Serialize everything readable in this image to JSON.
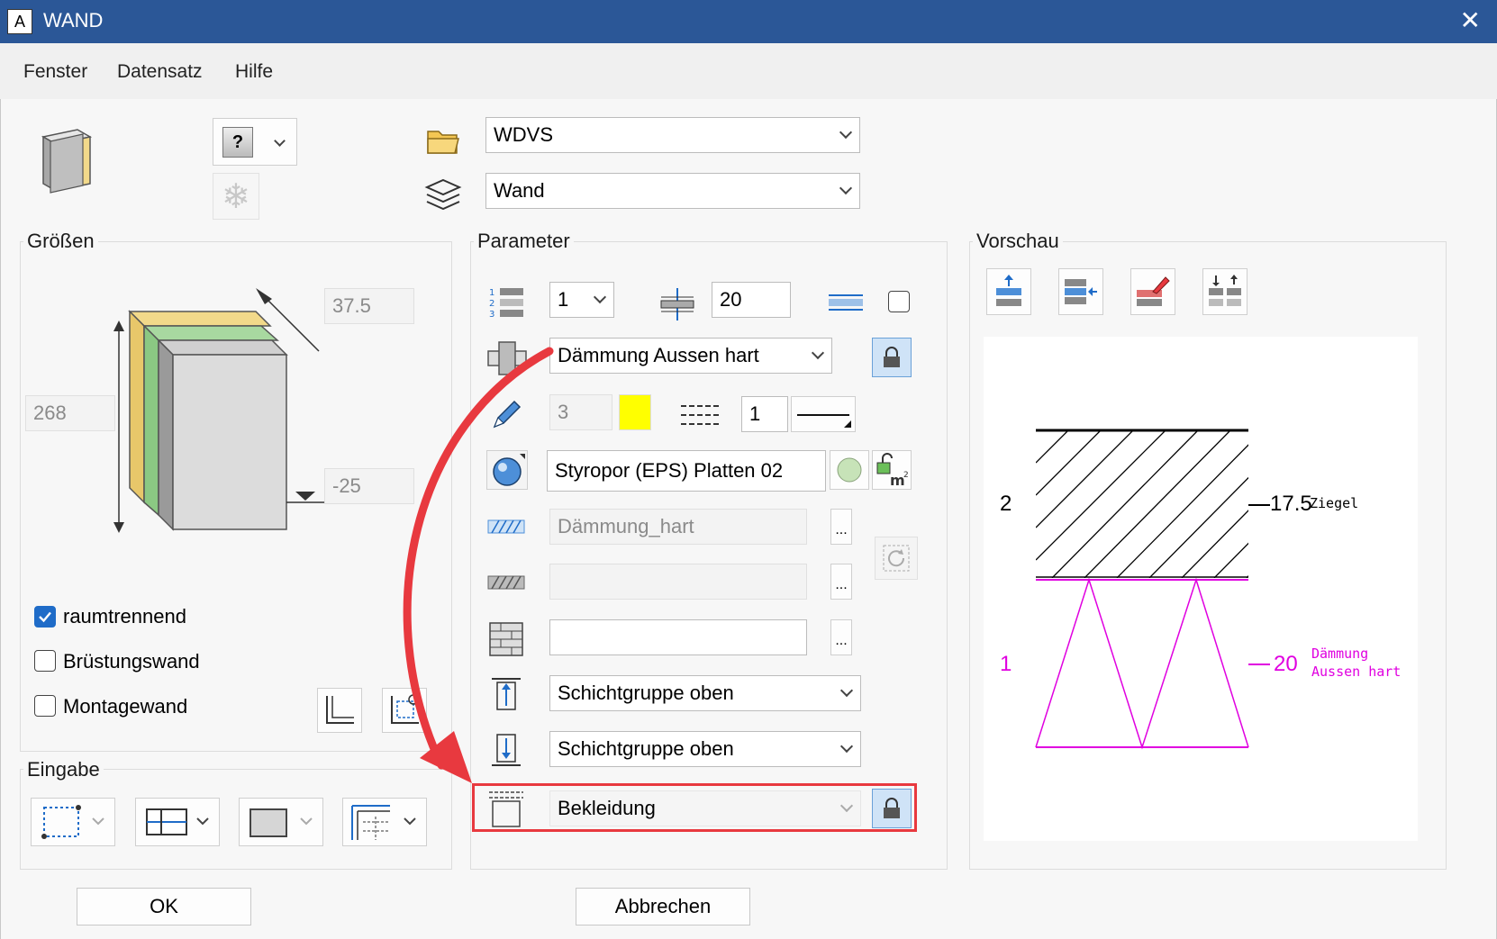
{
  "window": {
    "title": "WAND",
    "app_icon": "A",
    "close_glyph": "✕"
  },
  "menu": [
    "Fenster",
    "Datensatz",
    "Hilfe"
  ],
  "top": {
    "preset_combo": "WDVS",
    "layer_combo": "Wand",
    "help_icon_glyph": "?"
  },
  "groessen": {
    "title": "Größen",
    "width_value": "37.5",
    "height_value": "268",
    "offset_value": "-25",
    "checkboxes": [
      {
        "label": "raumtrennend",
        "checked": true
      },
      {
        "label": "Brüstungswand",
        "checked": false
      },
      {
        "label": "Montagewand",
        "checked": false
      }
    ]
  },
  "eingabe": {
    "title": "Eingabe"
  },
  "parameter": {
    "title": "Parameter",
    "layer_number": "1",
    "thickness": "20",
    "material_combo": "Dämmung Aussen hart",
    "pen_value": "3",
    "line_value": "1",
    "surface_name": "Styropor (EPS) Platten 02",
    "hatch_name": "Dämmung_hart",
    "pattern_name": "",
    "fill_name": "",
    "dots": "...",
    "top_group": "Schichtgruppe oben",
    "bottom_group": "Schichtgruppe oben",
    "cladding_combo": "Bekleidung",
    "colors": {
      "pen_color": "#ffff00",
      "highlight": "#e8393f"
    }
  },
  "vorschau": {
    "title": "Vorschau",
    "layer2_index": "2",
    "layer2_thickness": "17.5",
    "layer2_name": "Ziegel",
    "layer1_index": "1",
    "layer1_thickness": "20",
    "layer1_name_line1": "Dämmung",
    "layer1_name_line2": "Aussen hart",
    "colors": {
      "magenta": "#e000e0"
    }
  },
  "buttons": {
    "ok": "OK",
    "cancel": "Abbrechen"
  }
}
